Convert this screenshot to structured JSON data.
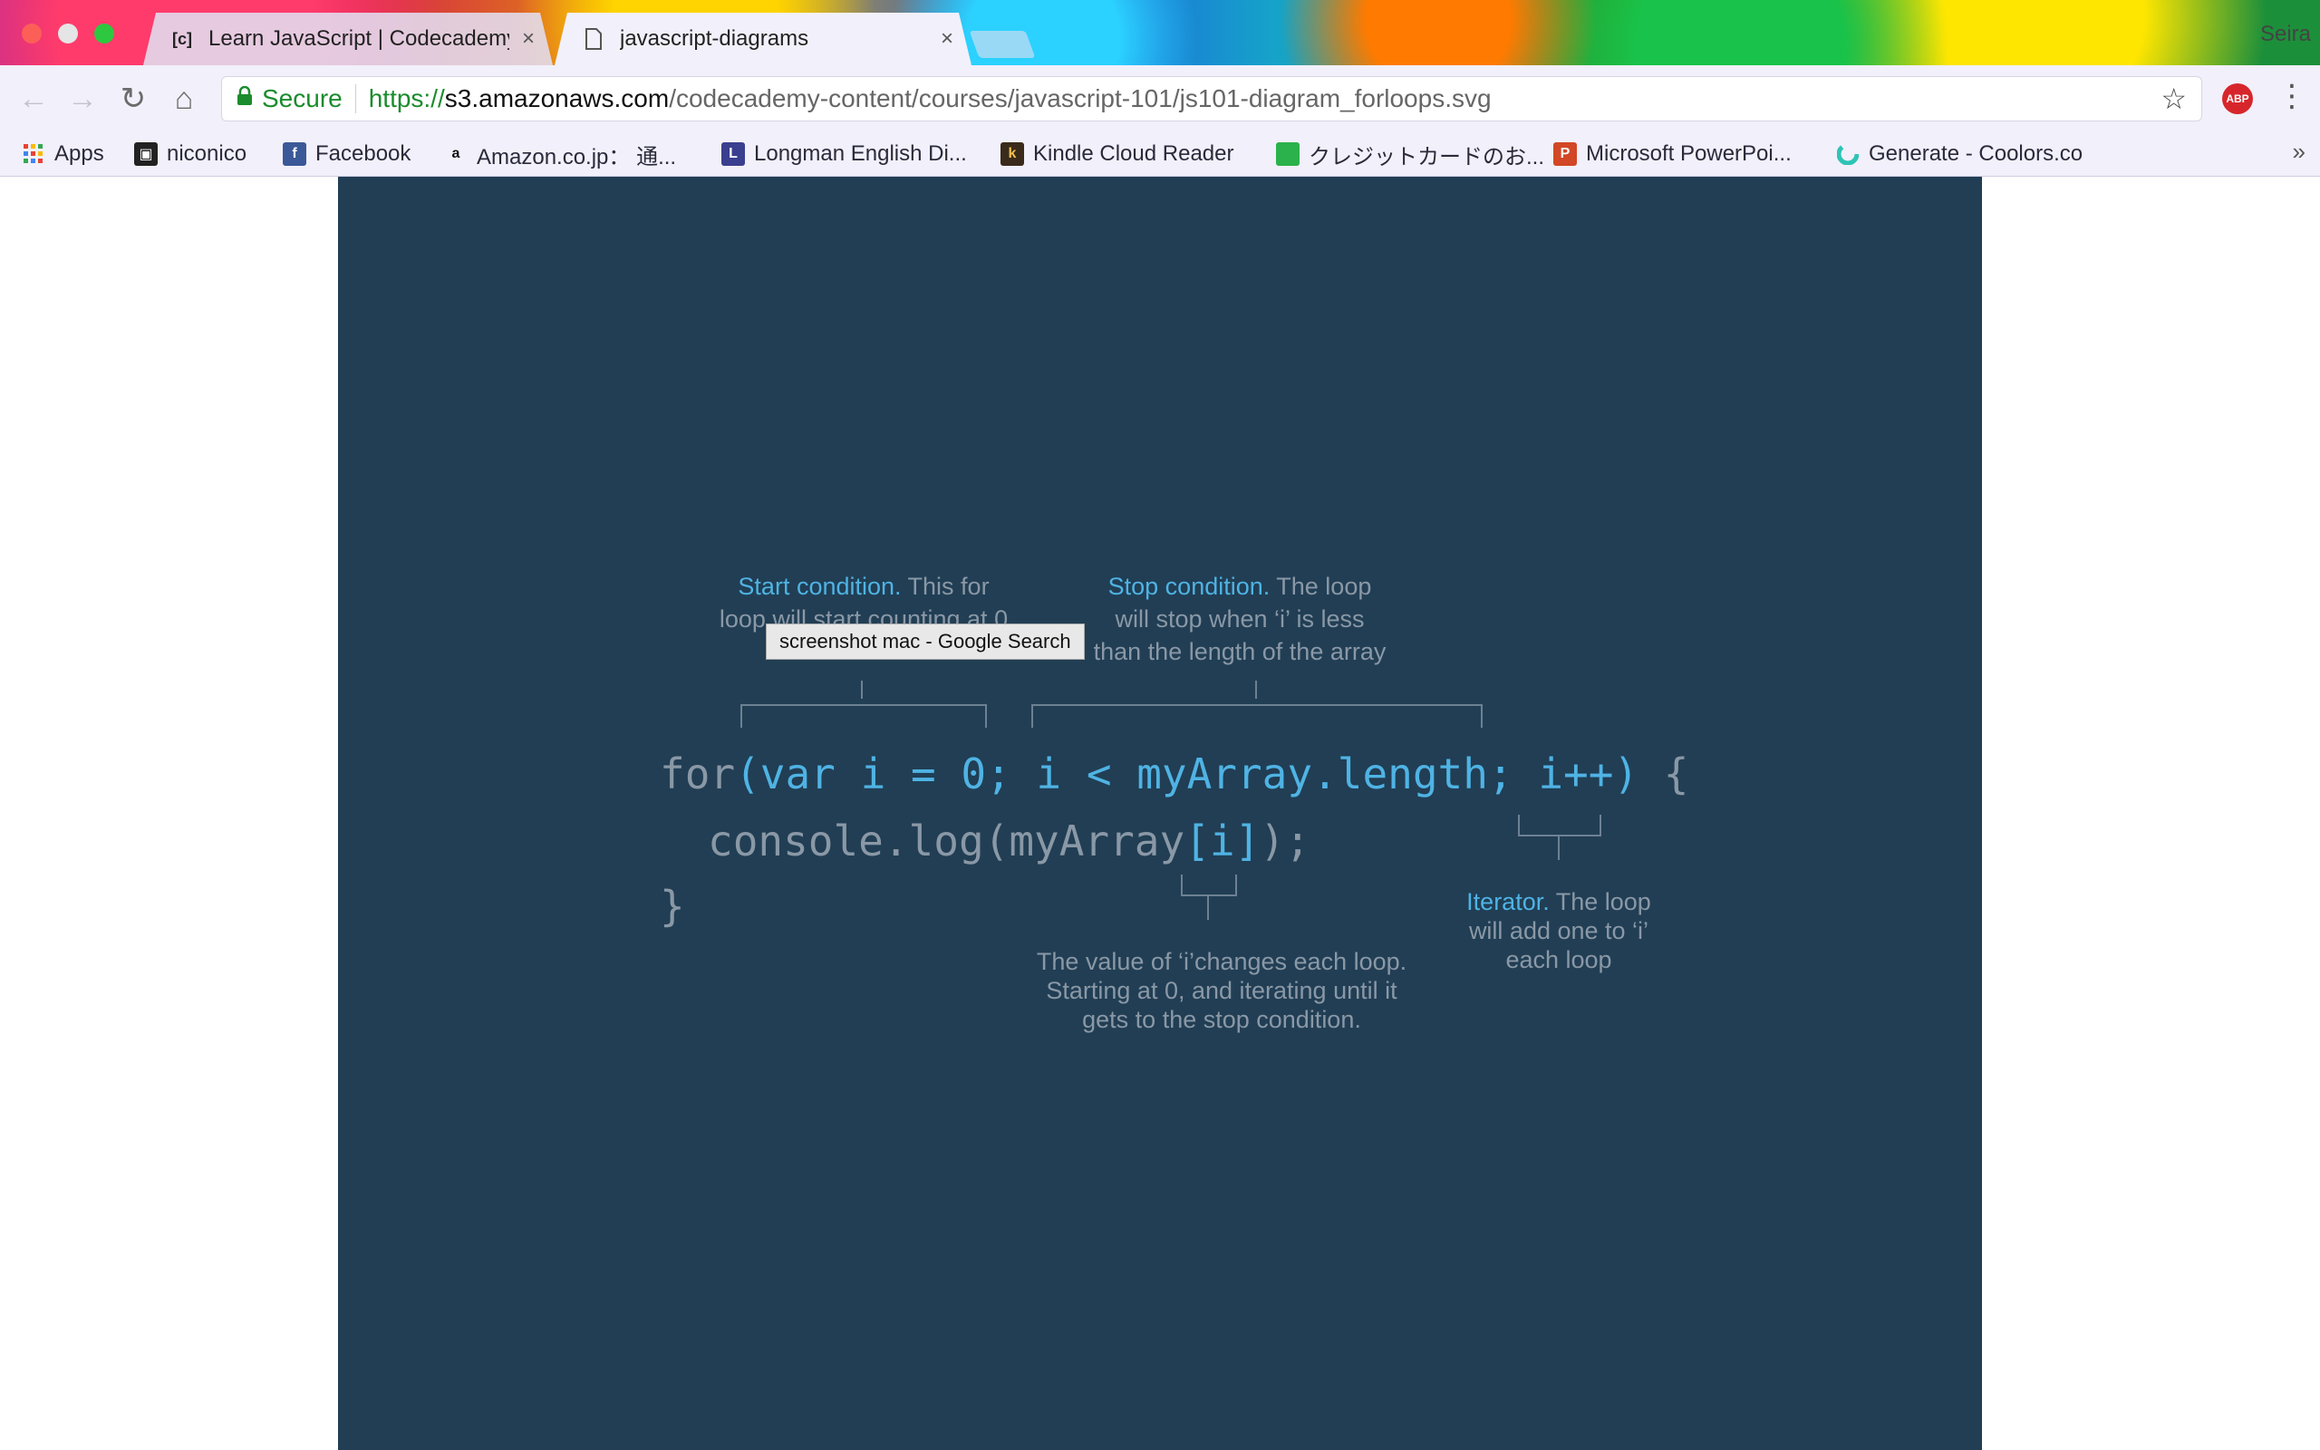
{
  "window": {
    "controls": [
      "close",
      "minimize",
      "zoom"
    ],
    "profile_name": "Seira"
  },
  "tabs": [
    {
      "title": "Learn JavaScript | Codecademy",
      "favicon": "codecademy-icon",
      "active": false,
      "close_label": "×"
    },
    {
      "title": "javascript-diagrams",
      "favicon": "document-icon",
      "active": true,
      "close_label": "×"
    }
  ],
  "toolbar": {
    "back_icon": "←",
    "forward_icon": "→",
    "reload_icon": "↻",
    "home_icon": "⌂",
    "secure_label": "Secure",
    "url_scheme": "https://",
    "url_host": "s3.amazonaws.com",
    "url_path": "/codecademy-content/courses/javascript-101/js101-diagram_forloops.svg",
    "star_icon": "☆",
    "extension_label": "ABP",
    "menu_icon": "⋮"
  },
  "bookmarks": {
    "items": [
      {
        "label": "Apps",
        "icon": "apps-grid-icon"
      },
      {
        "label": "niconico",
        "icon": "niconico-icon"
      },
      {
        "label": "Facebook",
        "icon": "facebook-icon"
      },
      {
        "label": "Amazon.co.jp： 通...",
        "icon": "amazon-icon"
      },
      {
        "label": "Longman English Di...",
        "icon": "longman-icon"
      },
      {
        "label": "Kindle Cloud Reader",
        "icon": "kindle-icon"
      },
      {
        "label": "クレジットカードのお...",
        "icon": "card-icon"
      },
      {
        "label": "Microsoft PowerPoi...",
        "icon": "powerpoint-icon"
      },
      {
        "label": "Generate - Coolors.co",
        "icon": "coolors-icon"
      }
    ],
    "more_label": "»"
  },
  "diagram": {
    "start_note": {
      "highlight": "Start condition.",
      "rest_line1": " This for",
      "line2": "loop will start counting at 0"
    },
    "stop_note": {
      "highlight": "Stop condition.",
      "rest_line1": " The loop",
      "line2": "will stop when ‘i’ is less",
      "line3": "than the length of the array"
    },
    "iterator_note": {
      "highlight": "Iterator.",
      "rest_line1": " The loop",
      "line2": "will add one to ‘i’",
      "line3": "each loop"
    },
    "value_note": {
      "line1": "The value of ‘i’changes each loop.",
      "line2": "Starting at 0, and iterating until it",
      "line3": "gets to the stop condition."
    },
    "code": {
      "line1_keyword": "for",
      "line1_paren": "(var i = 0; i < myArray.length; i++)",
      "line1_brace": " {",
      "line2_prefix": "console.log(myArray",
      "line2_index": "[i]",
      "line2_suffix": ");",
      "line3": "}"
    },
    "tooltip": "screenshot mac - Google Search",
    "colors": {
      "background": "#213e54",
      "highlight": "#4fb3e4",
      "muted": "#8a98a6"
    }
  }
}
